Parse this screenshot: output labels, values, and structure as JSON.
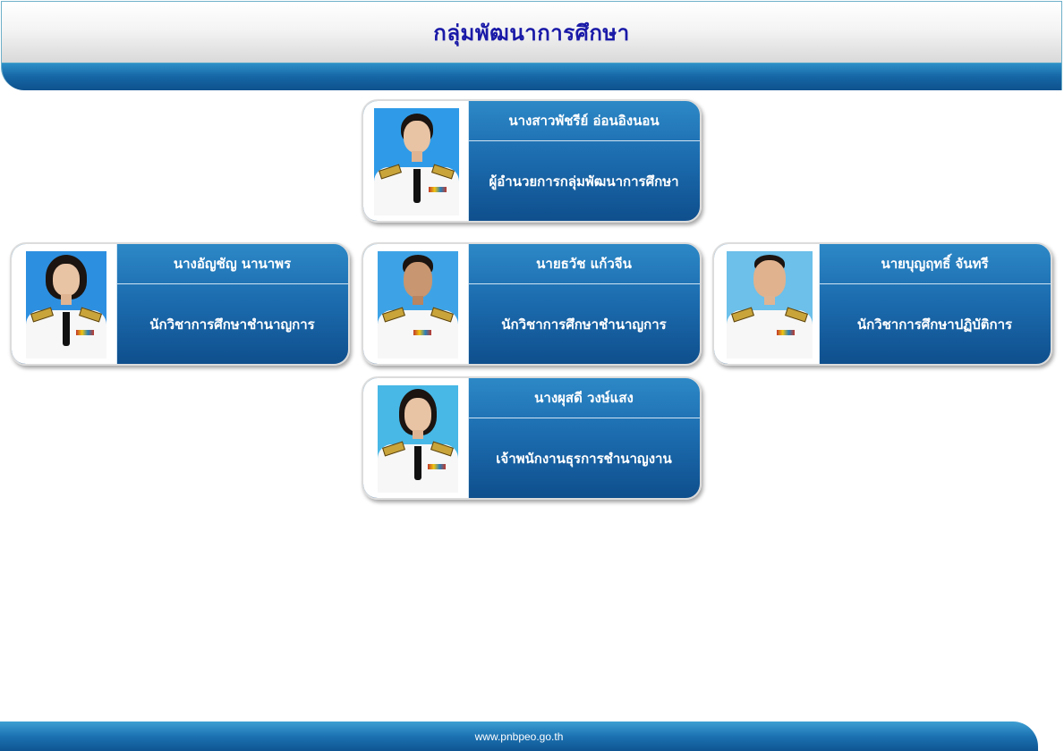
{
  "header": {
    "title": "กลุ่มพัฒนาการศึกษา"
  },
  "cards": [
    {
      "name": "นางสาวพัชรีย์  อ่อนอิงนอน",
      "position": "ผู้อำนวยการกลุ่มพัฒนาการศึกษา",
      "photo_bg": "#2f9be8"
    },
    {
      "name": "นางอัญชัญ  นานาพร",
      "position": "นักวิชาการศึกษาชำนาญการ",
      "photo_bg": "#2d8fe0"
    },
    {
      "name": "นายธวัช  แก้วจีน",
      "position": "นักวิชาการศึกษาชำนาญการ",
      "photo_bg": "#3ea3e6"
    },
    {
      "name": "นายบุญฤทธิ์  จันทรี",
      "position": "นักวิชาการศึกษาปฏิบัติการ",
      "photo_bg": "#6cc0ea"
    },
    {
      "name": "นางผุสดี  วงษ์แสง",
      "position": "เจ้าพนักงานธุรการชำนาญงาน",
      "photo_bg": "#48b8e6"
    }
  ],
  "footer": {
    "url": "www.pnbpeo.go.th"
  }
}
